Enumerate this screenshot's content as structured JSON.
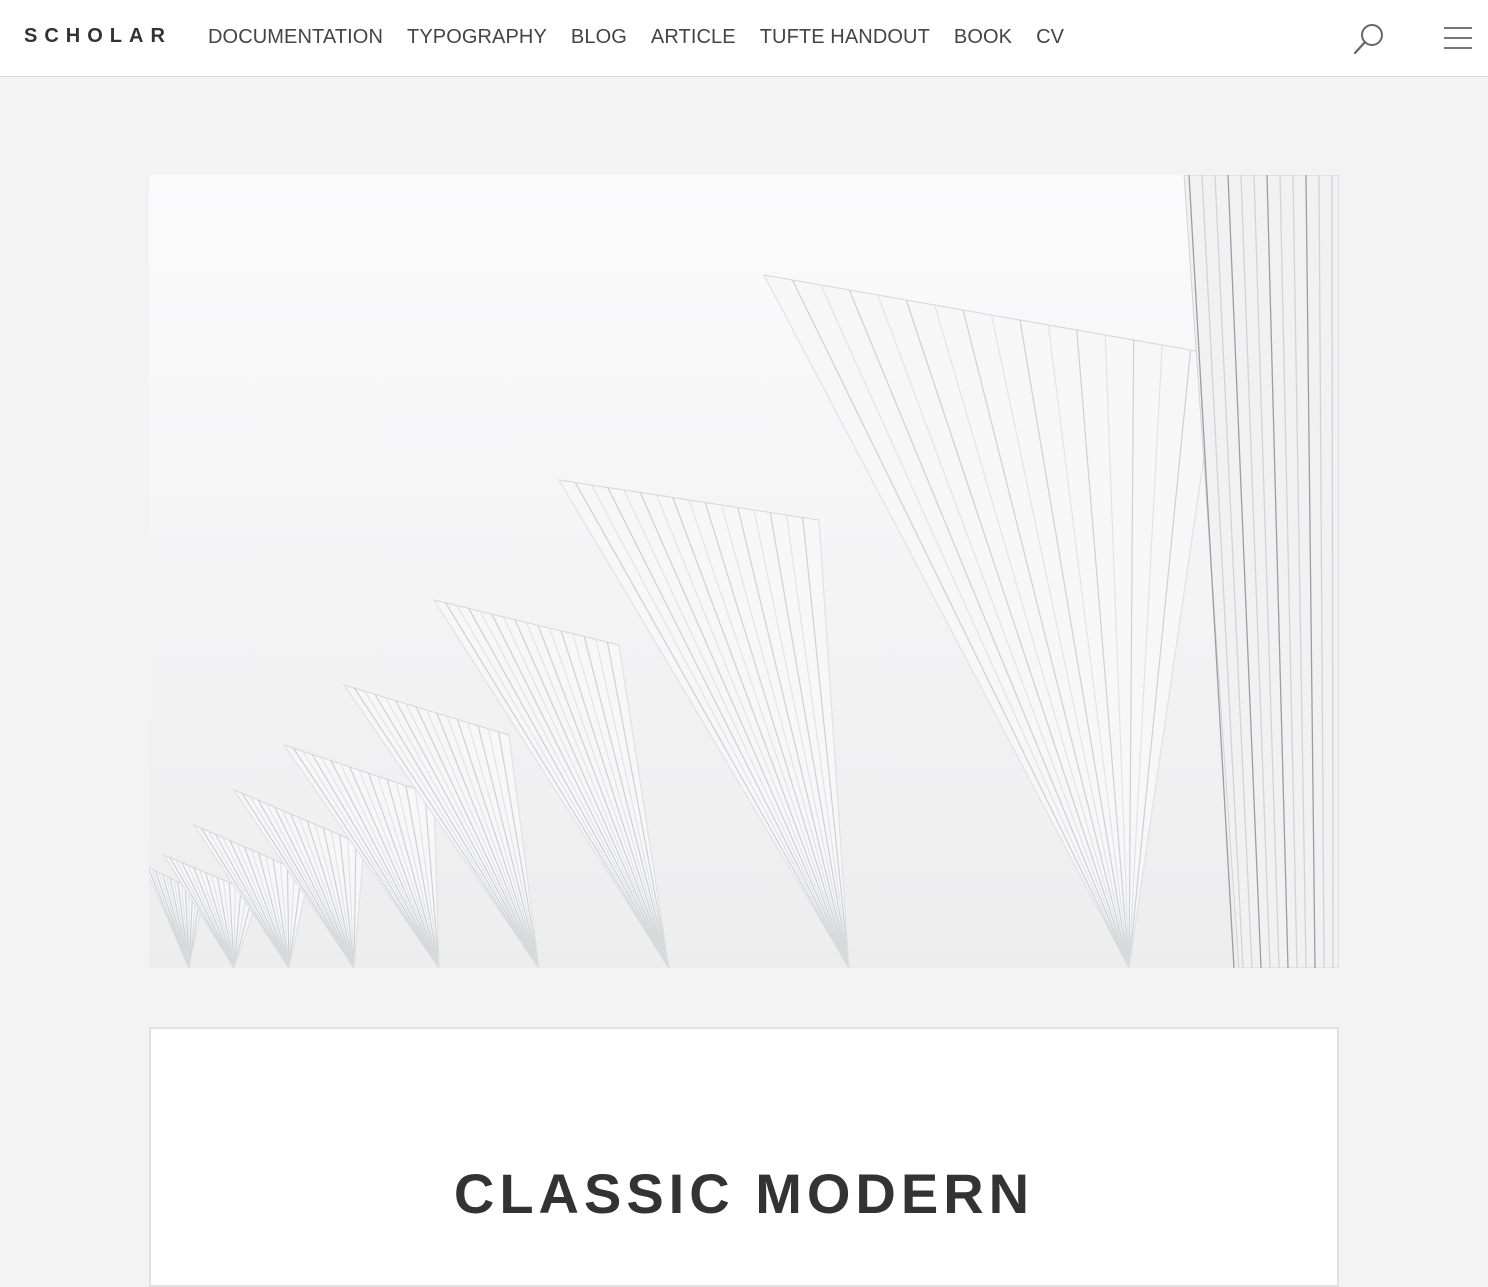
{
  "header": {
    "brand": "SCHOLAR",
    "nav": [
      {
        "label": "DOCUMENTATION"
      },
      {
        "label": "TYPOGRAPHY"
      },
      {
        "label": "BLOG"
      },
      {
        "label": "ARTICLE"
      },
      {
        "label": "TUFTE HANDOUT"
      },
      {
        "label": "BOOK"
      },
      {
        "label": "CV"
      }
    ],
    "icons": {
      "search": "search-icon",
      "menu": "hamburger-menu-icon"
    }
  },
  "main": {
    "title": "CLASSIC MODERN"
  },
  "colors": {
    "background": "#f3f3f3",
    "header_bg": "#ffffff",
    "text": "#333333"
  }
}
